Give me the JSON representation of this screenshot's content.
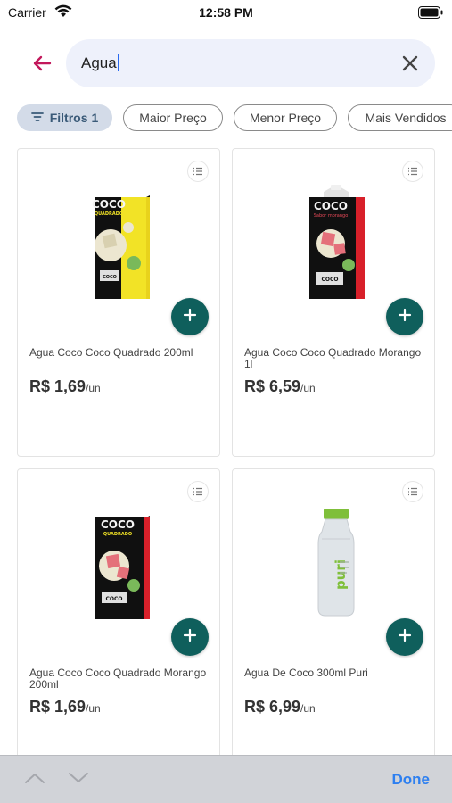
{
  "status_bar": {
    "carrier": "Carrier",
    "time": "12:58 PM",
    "wifi_icon": "wifi-icon",
    "battery_icon": "battery-full-icon"
  },
  "search": {
    "value": "Agua",
    "back_icon": "arrow-left-icon",
    "clear_icon": "close-icon"
  },
  "filters": {
    "filter_label": "Filtros",
    "filter_count": "1",
    "chips": [
      "Maior Preço",
      "Menor Preço",
      "Mais Vendidos"
    ]
  },
  "products": [
    {
      "name": "Agua Coco Coco Quadrado 200ml",
      "price": "R$ 1,69",
      "unit": "/un"
    },
    {
      "name": "Agua Coco Coco Quadrado Morango 1l",
      "price": "R$ 6,59",
      "unit": "/un"
    },
    {
      "name": "Agua Coco Coco Quadrado Morango 200ml",
      "price": "R$ 1,69",
      "unit": "/un"
    },
    {
      "name": "Agua De Coco 300ml Puri",
      "price": "R$ 6,99",
      "unit": "/un"
    }
  ],
  "product_images": [
    {
      "brand": "COCO",
      "sub": "QUADRADO",
      "bottom": "COCO"
    },
    {
      "brand": "COCO",
      "sub": "Sabor morango",
      "bottom": "COCO"
    },
    {
      "brand": "COCO",
      "sub": "QUADRADO",
      "bottom": "COCO"
    },
    {
      "brand": "puri"
    }
  ],
  "keyboard_bar": {
    "done_label": "Done"
  },
  "colors": {
    "accent": "#0f5f5c",
    "back_arrow": "#c2185b",
    "search_bg": "#eef1fb",
    "done": "#2d7ff0"
  }
}
